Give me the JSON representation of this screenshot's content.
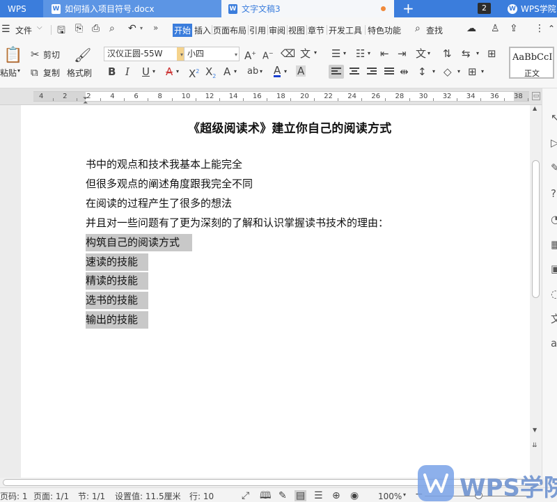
{
  "tabs": {
    "app": "WPS",
    "doc1": "如何插入项目符号.docx",
    "doc2": "文字文稿3",
    "add": "+",
    "count": "2",
    "academy": "WPS学院"
  },
  "menu": {
    "file": "文件",
    "items": [
      "开始",
      "插入",
      "页面布局",
      "引用",
      "审阅",
      "视图",
      "章节",
      "开发工具",
      "特色功能"
    ],
    "search": "查找"
  },
  "ribbon": {
    "paste": "粘贴",
    "cut": "剪切",
    "copy": "复制",
    "format_painter": "格式刷",
    "font": "汉仪正圆-55W",
    "size": "小四",
    "style_preview": "AaBbCcI",
    "style_name": "正文"
  },
  "ruler": {
    "labels": [
      "4",
      "2",
      "2",
      "4",
      "6",
      "8",
      "10",
      "12",
      "14",
      "16",
      "18",
      "20",
      "22",
      "24",
      "26",
      "28",
      "30",
      "32",
      "34",
      "36",
      "38"
    ]
  },
  "document": {
    "title": "《超级阅读术》建立你自己的阅读方式",
    "paragraphs": [
      "书中的观点和技术我基本上能完全",
      "但很多观点的阐述角度跟我完全不同",
      "在阅读的过程产生了很多的想法",
      "并且对一些问题有了更为深刻的了解和认识掌握读书技术的理由："
    ],
    "selected": [
      "构筑自己的阅读方式",
      "速读的技能",
      "精读的技能",
      "选书的技能",
      "输出的技能"
    ]
  },
  "status": {
    "page_code": "页码: 1",
    "page": "页面: 1/1",
    "section": "节: 1/1",
    "setting": "设置值: 11.5厘米",
    "row": "行: 10",
    "zoom": "100%"
  },
  "watermark": {
    "text": "WPS学院"
  },
  "colors": {
    "accent": "#3b7ddc",
    "selection": "#c8c8c8",
    "font_color_bar": "#1a3fd0"
  }
}
